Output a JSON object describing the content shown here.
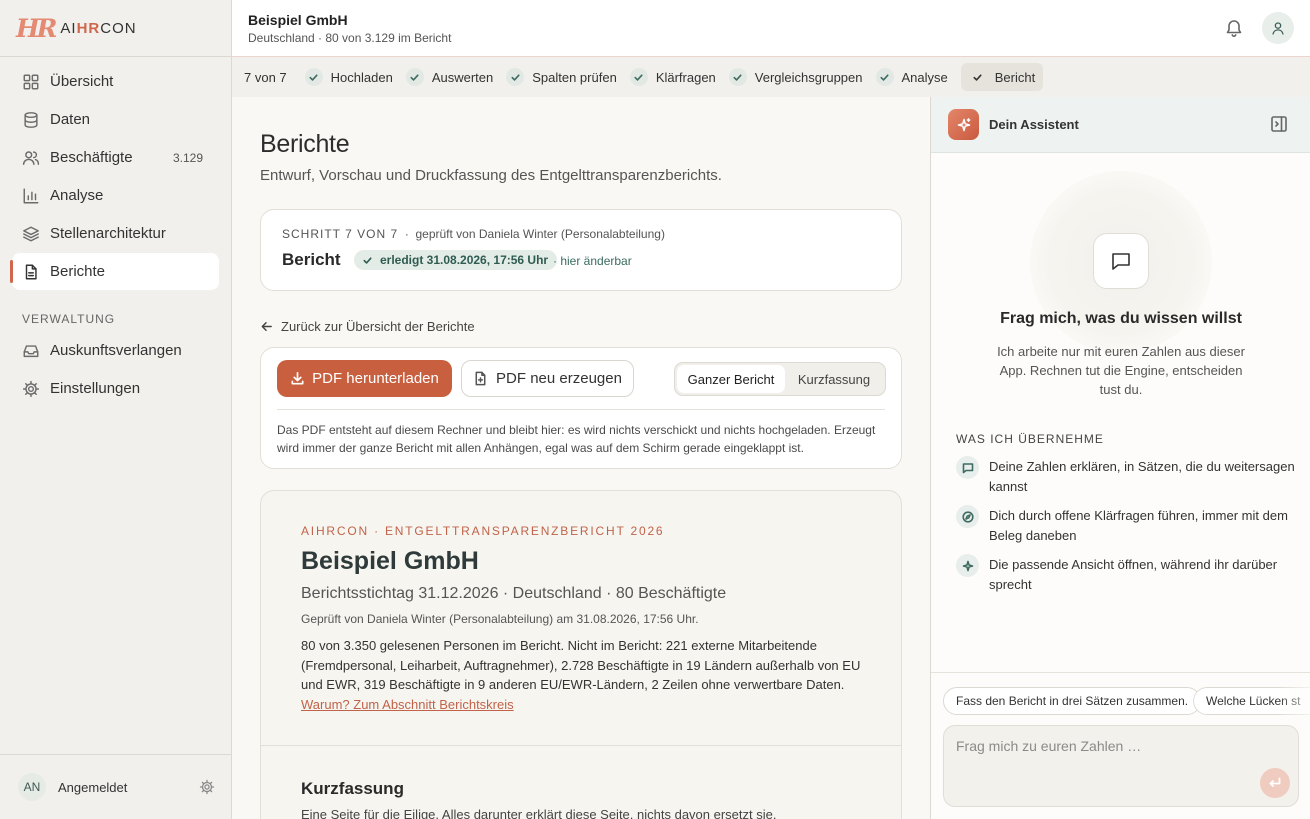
{
  "app": {
    "logo_text_pre": "AI",
    "logo_text_accent": "HR",
    "logo_text_post": "CON"
  },
  "header": {
    "company": "Beispiel GmbH",
    "subtitle": "Deutschland · 80 von 3.129 im Bericht"
  },
  "sidebar": {
    "items": [
      {
        "label": "Übersicht",
        "icon": "grid-icon"
      },
      {
        "label": "Daten",
        "icon": "database-icon"
      },
      {
        "label": "Beschäftigte",
        "icon": "users-icon",
        "count": "3.129"
      },
      {
        "label": "Analyse",
        "icon": "bar-chart-icon"
      },
      {
        "label": "Stellenarchitektur",
        "icon": "layers-icon"
      },
      {
        "label": "Berichte",
        "icon": "document-icon",
        "active": true
      }
    ],
    "section_label": "VERWALTUNG",
    "admin_items": [
      {
        "label": "Auskunftsverlangen",
        "icon": "inbox-icon"
      },
      {
        "label": "Einstellungen",
        "icon": "gear-icon"
      }
    ],
    "user": {
      "initials": "AN",
      "status": "Angemeldet"
    }
  },
  "steps": {
    "count": "7 von 7",
    "items": [
      "Hochladen",
      "Auswerten",
      "Spalten prüfen",
      "Klärfragen",
      "Vergleichsgruppen",
      "Analyse",
      "Bericht"
    ],
    "current": "Bericht"
  },
  "main": {
    "title": "Berichte",
    "subtitle": "Entwurf, Vorschau und Druckfassung des Entgelttransparenzberichts.",
    "step_card": {
      "step": "SCHRITT 7 VON 7",
      "sep": "·",
      "reviewed_by": "geprüft von Daniela Winter (Personalabteilung)",
      "title": "Bericht",
      "done_badge": "erledigt 31.08.2026, 17:56 Uhr",
      "change_hint": "· hier änderbar"
    },
    "back_link": "Zurück zur Übersicht der Berichte",
    "pdf": {
      "download": "PDF herunterladen",
      "regenerate": "PDF neu erzeugen",
      "toggle": [
        "Ganzer Bericht",
        "Kurzfassung"
      ],
      "toggle_selected": "Ganzer Bericht",
      "note": "Das PDF entsteht auf diesem Rechner und bleibt hier: es wird nichts verschickt und nichts hochgeladen. Erzeugt wird immer der ganze Bericht mit allen Anhängen, egal was auf dem Schirm gerade eingeklappt ist."
    },
    "report": {
      "eyebrow": "AIHRCON · ENTGELTTRANSPARENZBERICHT 2026",
      "company": "Beispiel GmbH",
      "stichtag": "Berichtsstichtag 31.12.2026 · Deutschland · 80 Beschäftigte",
      "reviewed": "Geprüft von Daniela Winter (Personalabteilung) am 31.08.2026, 17:56 Uhr.",
      "body": "80 von 3.350 gelesenen Personen im Bericht. Nicht im Bericht: 221 externe Mitarbeitende (Fremdpersonal, Leiharbeit, Auftragnehmer), 2.728 Beschäftigte in 19 Ländern außerhalb von EU und EWR, 319 Beschäftigte in 9 anderen EU/EWR-Ländern, 2 Zeilen ohne verwertbare Daten.",
      "link": "Warum? Zum Abschnitt Berichtskreis",
      "summary_title": "Kurzfassung",
      "summary_sub": "Eine Seite für die Eilige. Alles darunter erklärt diese Seite, nichts davon ersetzt sie."
    }
  },
  "assistant": {
    "name": "Dein Assistent",
    "headline": "Frag mich, was du wissen willst",
    "description": "Ich arbeite nur mit euren Zahlen aus dieser App. Rechnen tut die Engine, entscheiden tust du.",
    "features_label": "WAS ICH ÜBERNEHME",
    "features": [
      "Deine Zahlen erklären, in Sätzen, die du weitersagen kannst",
      "Dich durch offene Klärfragen führen, immer mit dem Beleg daneben",
      "Die passende Ansicht öffnen, während ihr darüber sprecht"
    ],
    "chips": [
      "Fass den Bericht in drei Sätzen zusammen.",
      "Welche Lücken st"
    ],
    "placeholder": "Frag mich zu euren Zahlen …"
  },
  "colors": {
    "accent": "#c8603f",
    "teal": "#2f5c51",
    "sidebar_bg": "#f1f0ec"
  }
}
